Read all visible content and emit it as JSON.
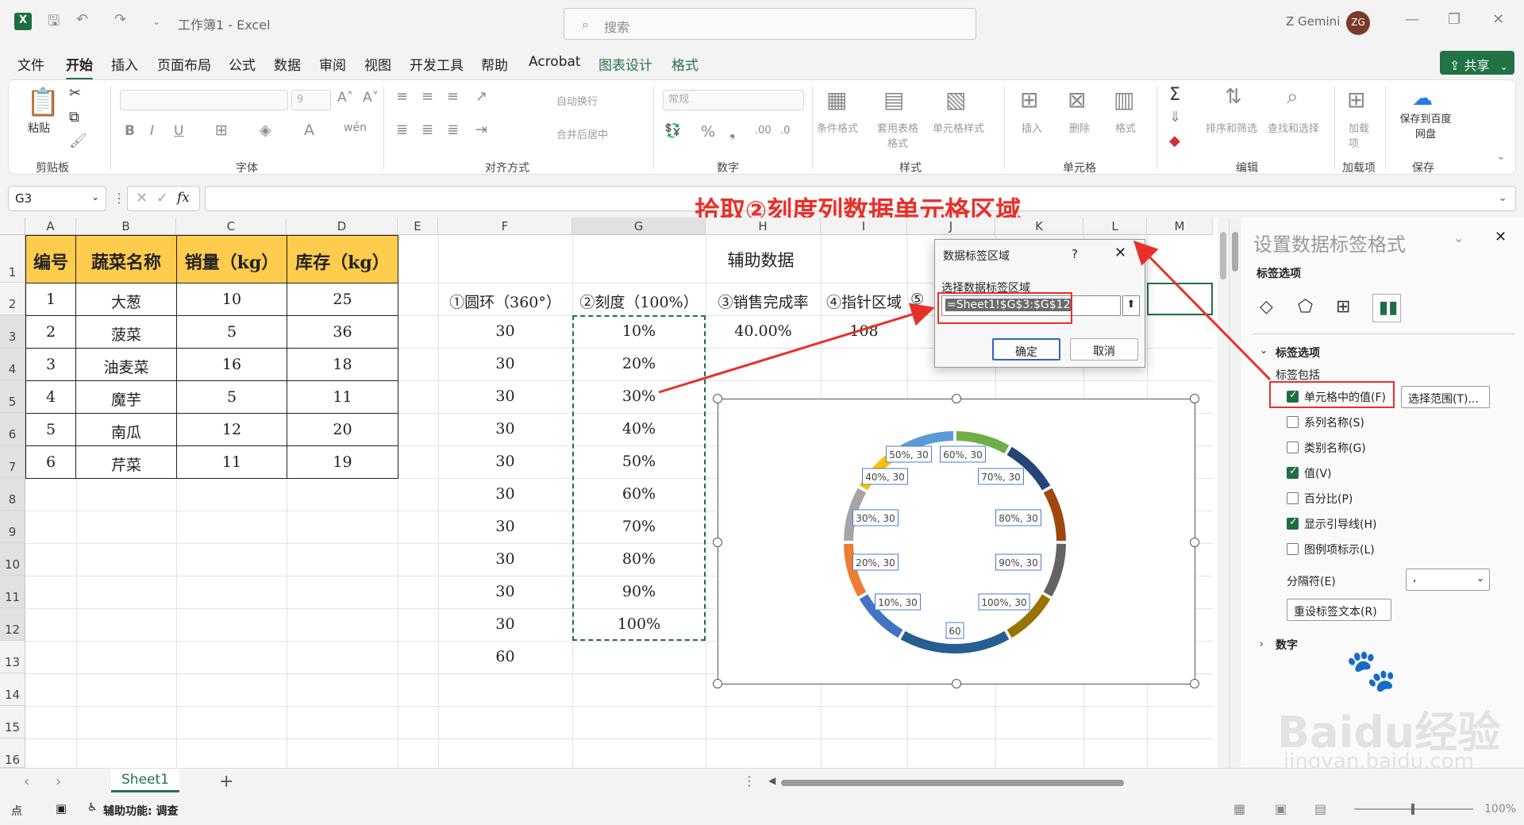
{
  "window": {
    "title": "工作簿1 - Excel",
    "user": "Z Gemini",
    "avatar": "ZG"
  },
  "search": {
    "placeholder": "搜索"
  },
  "menu": {
    "items": [
      "文件",
      "开始",
      "插入",
      "页面布局",
      "公式",
      "数据",
      "审阅",
      "视图",
      "开发工具",
      "帮助",
      "Acrobat",
      "图表设计",
      "格式"
    ],
    "share_label": "共享"
  },
  "ribbon": {
    "paste": "粘贴",
    "groups": [
      "剪贴板",
      "字体",
      "对齐方式",
      "数字",
      "样式",
      "单元格",
      "编辑",
      "加载项",
      "保存"
    ],
    "wrap_text": "自动换行",
    "merge_center": "合并后居中",
    "number_format": "常规",
    "font_size": "9",
    "cond_format": "条件格式",
    "table_format": "套用表格格式",
    "cell_style": "单元格样式",
    "insert": "插入",
    "delete": "删除",
    "format": "格式",
    "sort_filter": "排序和筛选",
    "find_select": "查找和选择",
    "addins": "加载项",
    "save_to": "保存到百度网盘"
  },
  "formula_bar": {
    "name_box": "G3",
    "fx": "fx"
  },
  "annotation": "拾取②刻度列数据单元格区域",
  "sheet": {
    "columns": [
      "A",
      "B",
      "C",
      "D",
      "E",
      "F",
      "G",
      "H",
      "I",
      "J",
      "K",
      "L",
      "M"
    ],
    "rows": [
      "1",
      "2",
      "3",
      "4",
      "5",
      "6",
      "7",
      "8",
      "9",
      "10",
      "11",
      "12",
      "13",
      "14",
      "15",
      "16"
    ],
    "table_headers": [
      "编号",
      "蔬菜名称",
      "销量（kg）",
      "库存（kg）"
    ],
    "table_rows": [
      [
        "1",
        "大葱",
        "10",
        "25"
      ],
      [
        "2",
        "菠菜",
        "5",
        "36"
      ],
      [
        "3",
        "油麦菜",
        "16",
        "18"
      ],
      [
        "4",
        "魔芋",
        "5",
        "11"
      ],
      [
        "5",
        "南瓜",
        "12",
        "20"
      ],
      [
        "6",
        "芹菜",
        "11",
        "19"
      ]
    ],
    "aux_title": "辅助数据",
    "aux_headers": [
      "①圆环（360°）",
      "②刻度（100%）",
      "③销售完成率",
      "④指针区域",
      "⑤"
    ],
    "col_f": [
      "30",
      "30",
      "30",
      "30",
      "30",
      "30",
      "30",
      "30",
      "30",
      "30",
      "60"
    ],
    "col_g": [
      "10%",
      "20%",
      "30%",
      "40%",
      "50%",
      "60%",
      "70%",
      "80%",
      "90%",
      "100%"
    ],
    "h3": "40.00%",
    "i3": "108"
  },
  "dialog": {
    "title": "数据标签区域",
    "help": "?",
    "label": "选择数据标签区域",
    "range": "=Sheet1!$G$3:$G$12",
    "ok": "确定",
    "cancel": "取消"
  },
  "chart_labels": [
    "50%, 30",
    "60%, 30",
    "70%, 30",
    "80%, 30",
    "90%, 30",
    "100%, 30",
    "60",
    "10%, 30",
    "20%, 30",
    "30%, 30",
    "40%, 30"
  ],
  "pane": {
    "title": "设置数据标签格式",
    "tab_label": "标签选项",
    "section": "标签选项",
    "contains": "标签包括",
    "options": [
      {
        "label": "单元格中的值(F)",
        "checked": true
      },
      {
        "label": "系列名称(S)",
        "checked": false
      },
      {
        "label": "类别名称(G)",
        "checked": false
      },
      {
        "label": "值(V)",
        "checked": true
      },
      {
        "label": "百分比(P)",
        "checked": false
      },
      {
        "label": "显示引导线(H)",
        "checked": true
      },
      {
        "label": "图例项标示(L)",
        "checked": false
      }
    ],
    "select_range": "选择范围(T)...",
    "separator_label": "分隔符(E)",
    "separator_value": ",",
    "reset": "重设标签文本(R)",
    "number": "数字"
  },
  "tabs": {
    "sheet": "Sheet1"
  },
  "status": {
    "mode": "点",
    "accessibility": "辅助功能: 调查",
    "zoom": "100%"
  },
  "watermark": {
    "brand": "Baidu经验",
    "url": "jingyan.baidu.com"
  }
}
